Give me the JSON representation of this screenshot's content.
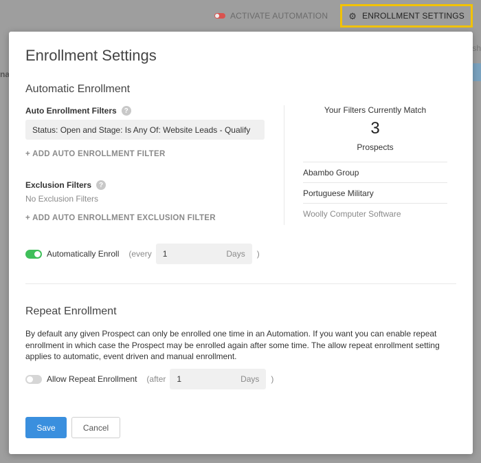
{
  "topbar": {
    "activate_label": "ACTIVATE AUTOMATION",
    "enrollment_settings_label": "ENROLLMENT SETTINGS",
    "bg_fragment_left": "na",
    "bg_fragment_right": "sh"
  },
  "modal": {
    "title": "Enrollment Settings",
    "automatic": {
      "section_title": "Automatic Enrollment",
      "filters_label": "Auto Enrollment Filters",
      "filter_value": "Status: Open and Stage: Is Any Of: Website Leads - Qualify",
      "add_filter": "+ ADD AUTO ENROLLMENT FILTER",
      "exclusion_label": "Exclusion Filters",
      "no_exclusion": "No Exclusion Filters",
      "add_exclusion": "+ ADD AUTO ENROLLMENT EXCLUSION FILTER",
      "auto_enroll_label": "Automatically Enroll",
      "auto_enroll_on": true,
      "every_label": "(every",
      "every_value": "1",
      "every_unit": "Days",
      "close_paren": ")"
    },
    "match": {
      "title": "Your Filters Currently Match",
      "count": "3",
      "unit": "Prospects",
      "items": [
        "Abambo Group",
        "Portuguese Military",
        "Woolly Computer Software"
      ]
    },
    "repeat": {
      "section_title": "Repeat Enrollment",
      "description": "By default any given Prospect can only be enrolled one time in an Automation. If you want you can enable repeat enrollment in which case the Prospect may be enrolled again after some time. The allow repeat enrollment setting applies to automatic, event driven and manual enrollment.",
      "allow_label": "Allow Repeat Enrollment",
      "allow_on": false,
      "after_label": "(after",
      "after_value": "1",
      "after_unit": "Days",
      "close_paren": ")"
    },
    "buttons": {
      "save": "Save",
      "cancel": "Cancel"
    }
  },
  "colors": {
    "highlight": "#f2c200",
    "primary": "#3a8fde",
    "toggle_on": "#3fbf5a",
    "toggle_activate": "#d9534f"
  }
}
